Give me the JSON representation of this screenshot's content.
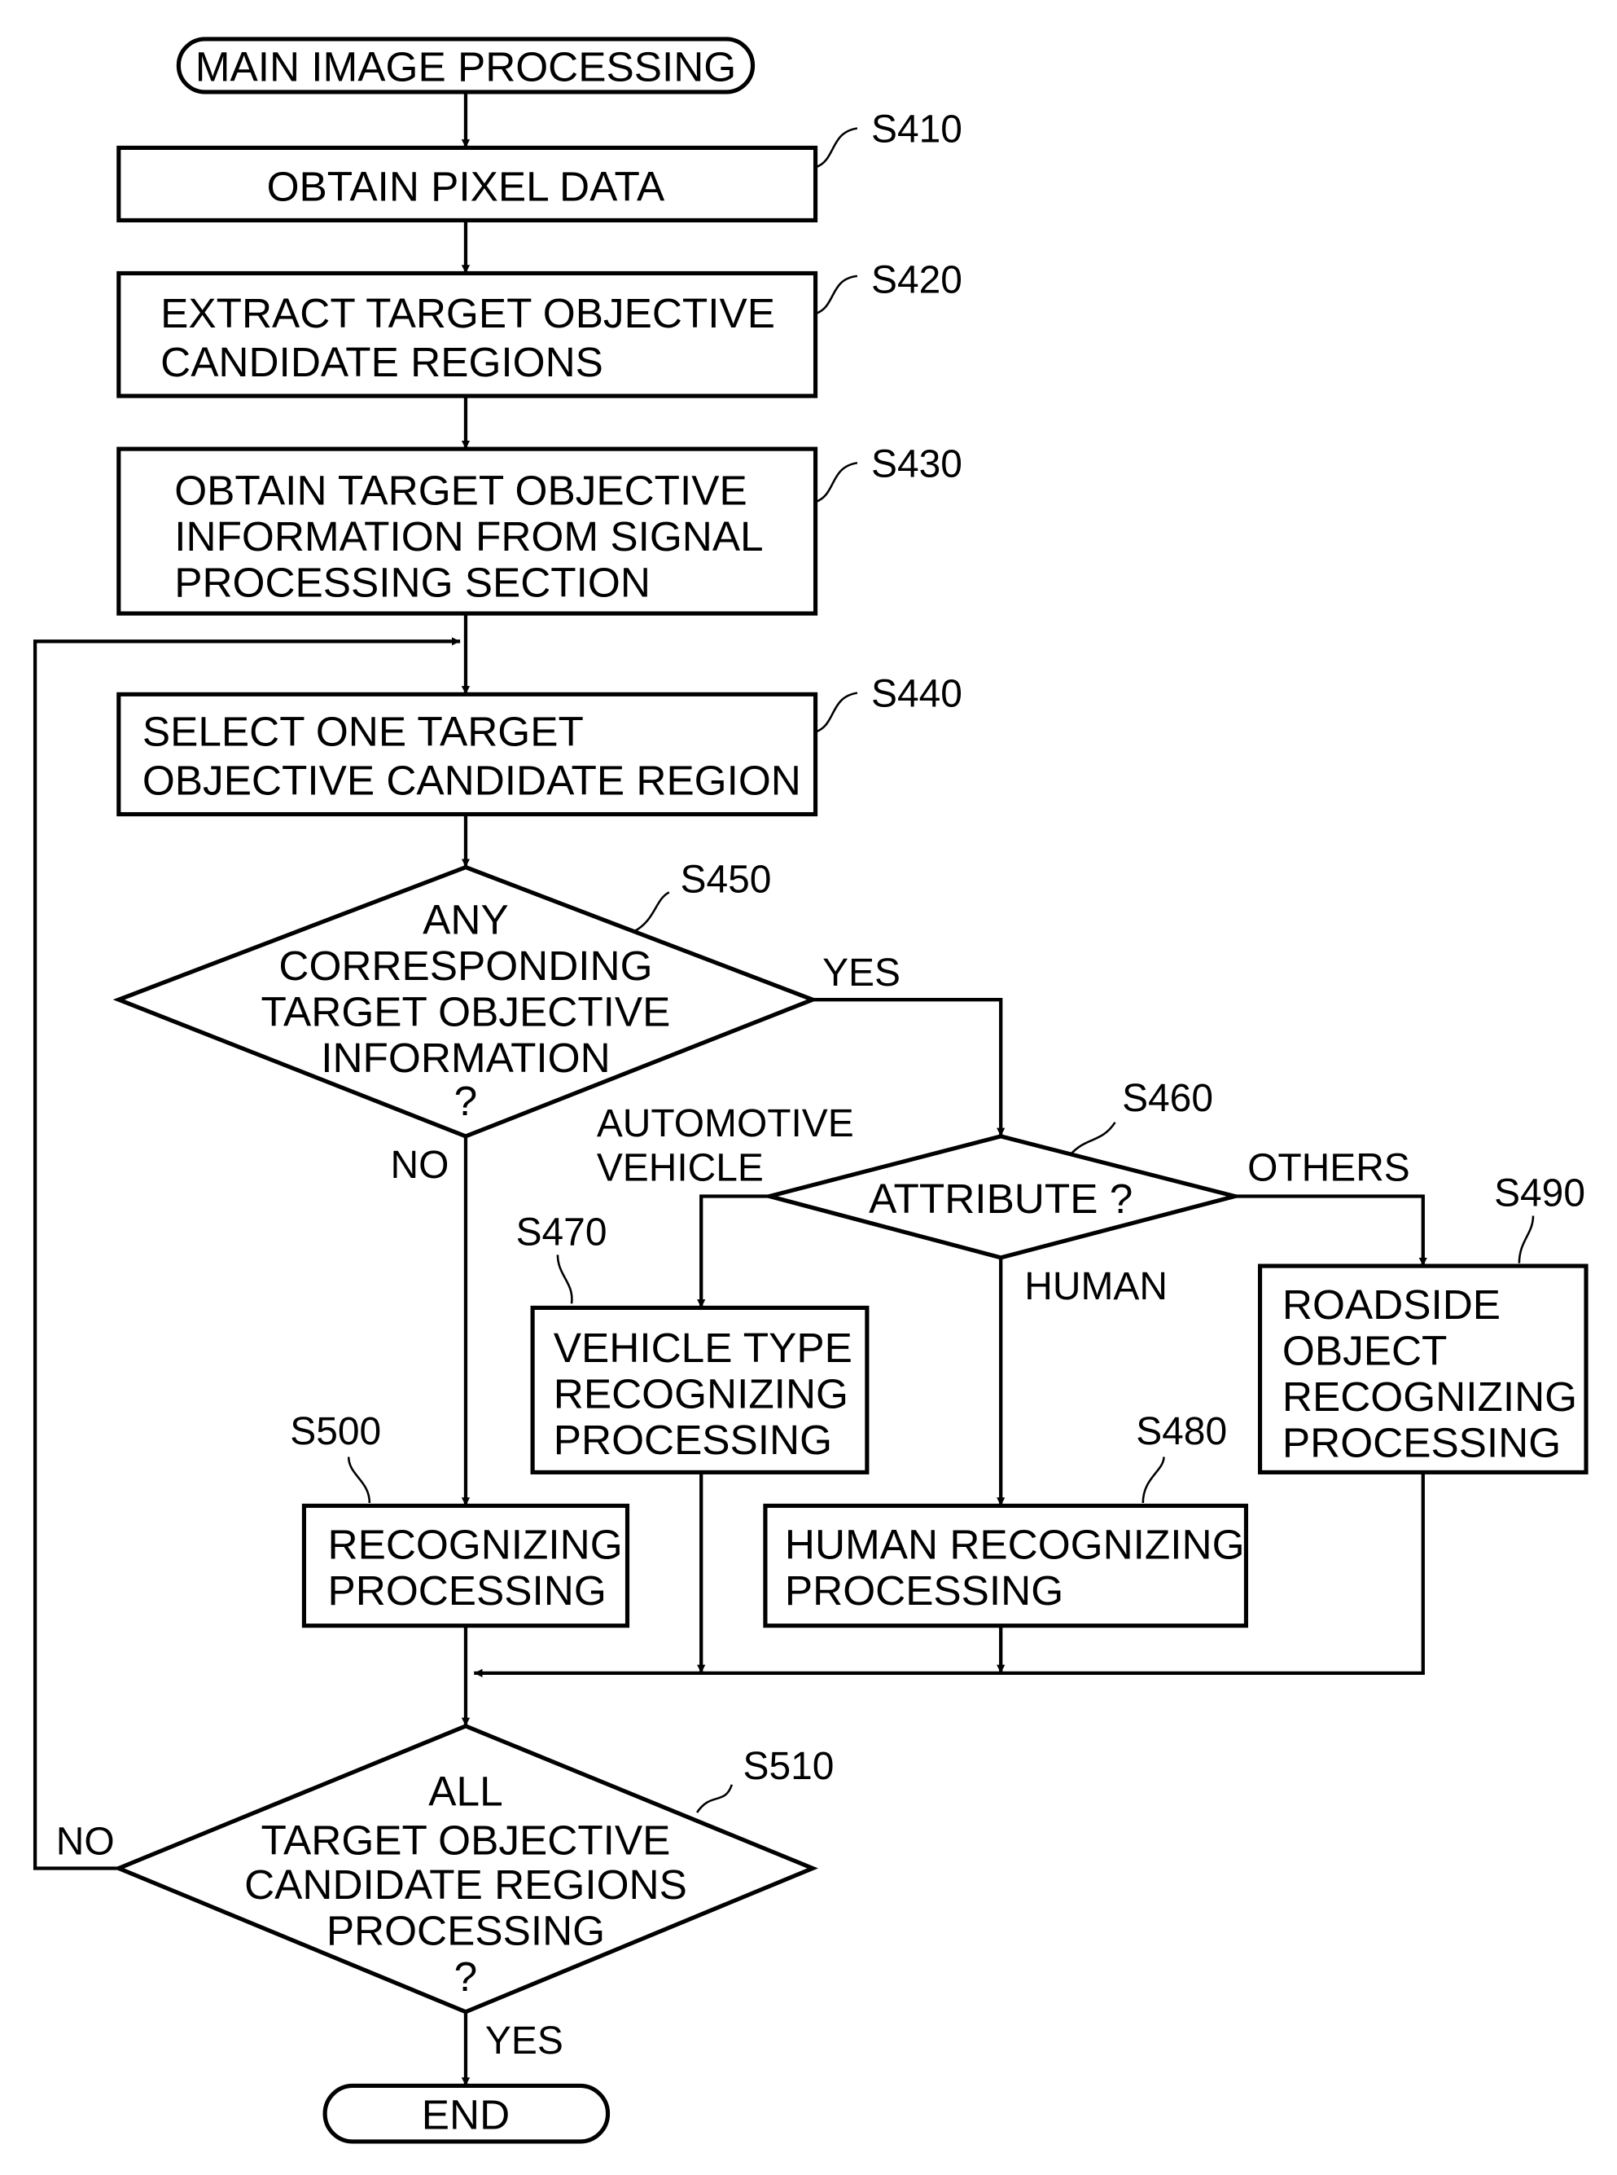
{
  "title": "MAIN IMAGE PROCESSING",
  "end": "END",
  "steps": {
    "s410": {
      "id": "S410",
      "lines": [
        "OBTAIN PIXEL DATA"
      ]
    },
    "s420": {
      "id": "S420",
      "lines": [
        "EXTRACT TARGET OBJECTIVE",
        "CANDIDATE REGIONS"
      ]
    },
    "s430": {
      "id": "S430",
      "lines": [
        "OBTAIN TARGET OBJECTIVE",
        "INFORMATION FROM SIGNAL",
        "PROCESSING SECTION"
      ]
    },
    "s440": {
      "id": "S440",
      "lines": [
        "SELECT ONE TARGET",
        "OBJECTIVE CANDIDATE REGION"
      ]
    },
    "s450": {
      "id": "S450",
      "lines": [
        "ANY",
        "CORRESPONDING",
        "TARGET OBJECTIVE",
        "INFORMATION",
        "?"
      ]
    },
    "s460": {
      "id": "S460",
      "lines": [
        "ATTRIBUTE ?"
      ]
    },
    "s470": {
      "id": "S470",
      "lines": [
        "VEHICLE TYPE",
        "RECOGNIZING",
        "PROCESSING"
      ]
    },
    "s480": {
      "id": "S480",
      "lines": [
        "HUMAN RECOGNIZING",
        "PROCESSING"
      ]
    },
    "s490": {
      "id": "S490",
      "lines": [
        "ROADSIDE",
        "OBJECT",
        "RECOGNIZING",
        "PROCESSING"
      ]
    },
    "s500": {
      "id": "S500",
      "lines": [
        "RECOGNIZING",
        "PROCESSING"
      ]
    },
    "s510": {
      "id": "S510",
      "lines": [
        "ALL",
        "TARGET OBJECTIVE",
        "CANDIDATE REGIONS",
        "PROCESSING",
        "?"
      ]
    }
  },
  "branches": {
    "s450_yes": "YES",
    "s450_no": "NO",
    "s460_vehicle": [
      "AUTOMOTIVE",
      "VEHICLE"
    ],
    "s460_human": "HUMAN",
    "s460_others": "OTHERS",
    "s510_no": "NO",
    "s510_yes": "YES"
  }
}
